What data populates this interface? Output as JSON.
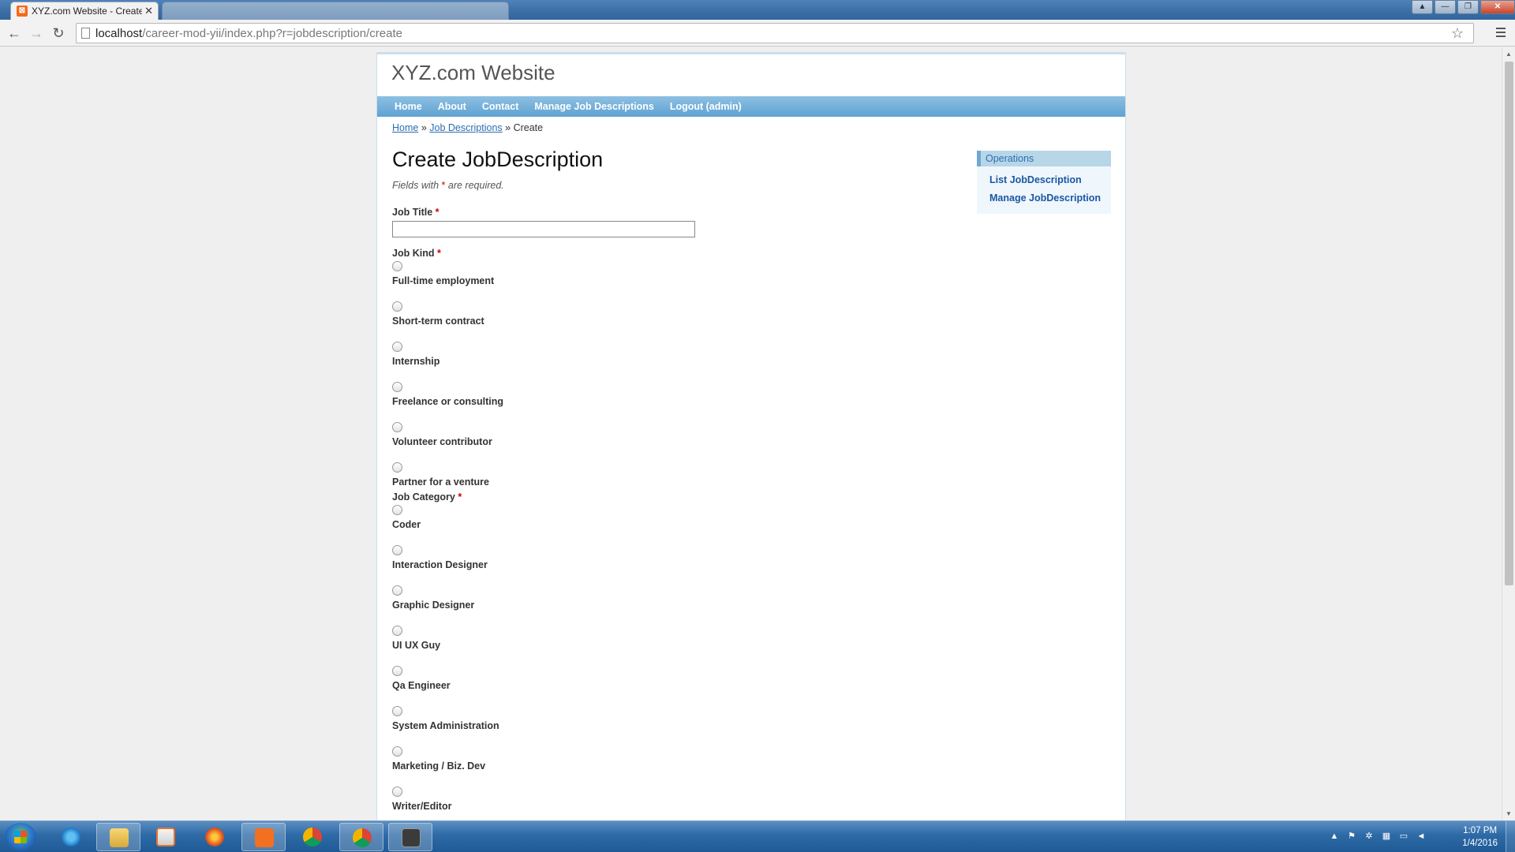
{
  "browser": {
    "active_tab": {
      "title": "XYZ.com Website - Create",
      "close": "✕"
    },
    "url_host": "localhost",
    "url_path": "/career-mod-yii/index.php?r=jobdescription/create"
  },
  "site": {
    "title": "XYZ.com Website",
    "menu": [
      "Home",
      "About",
      "Contact",
      "Manage Job Descriptions",
      "Logout (admin)"
    ],
    "breadcrumbs": {
      "home": "Home",
      "sep": "»",
      "section": "Job Descriptions",
      "current": "Create"
    }
  },
  "form": {
    "heading": "Create JobDescription",
    "required_note_prefix": "Fields with",
    "required_star": "*",
    "required_note_suffix": "are required.",
    "job_title_label": "Job Title",
    "job_title_value": "",
    "job_kind_label": "Job Kind",
    "job_kind_options": [
      "Full-time employment",
      "Short-term contract",
      "Internship",
      "Freelance or consulting",
      "Volunteer contributor",
      "Partner for a venture"
    ],
    "job_category_label": "Job Category",
    "job_category_options": [
      "Coder",
      "Interaction Designer",
      "Graphic Designer",
      "UI UX Guy",
      "Qa Engineer",
      "System Administration",
      "Marketing / Biz. Dev",
      "Writer/Editor"
    ]
  },
  "sidebar": {
    "title": "Operations",
    "items": [
      "List JobDescription",
      "Manage JobDescription"
    ]
  },
  "taskbar": {
    "time": "1:07 PM",
    "date": "1/4/2016",
    "apps": [
      "ie-icon",
      "explorer-icon",
      "media-player-icon",
      "firefox-icon",
      "xampp-icon",
      "chrome-icon",
      "chrome-icon",
      "sublime-text-icon"
    ]
  },
  "colors": {
    "menu_bar": "#5ea2d2",
    "link": "#2c6fb2",
    "required": "#cc0000",
    "portlet_title_bg": "#b7d6e7"
  }
}
